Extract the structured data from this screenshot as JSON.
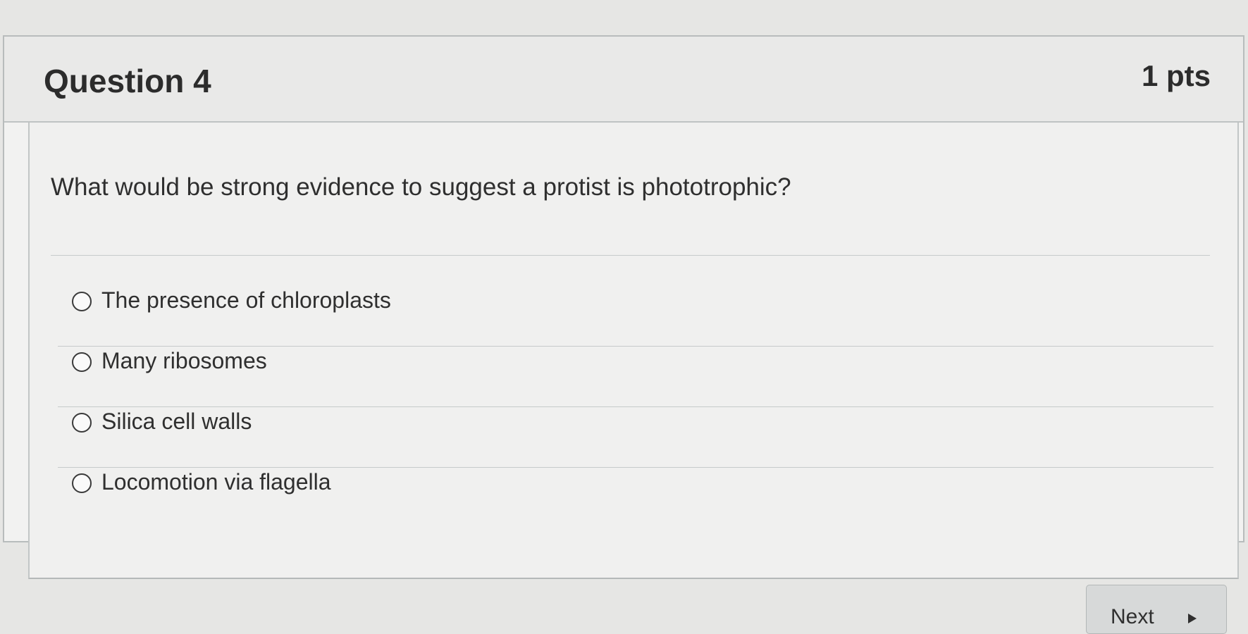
{
  "question": {
    "title": "Question 4",
    "points": "1 pts",
    "text": "What would be strong evidence to suggest a protist is phototrophic?",
    "answers": [
      {
        "label": "The presence of chloroplasts"
      },
      {
        "label": "Many ribosomes"
      },
      {
        "label": "Silica cell walls"
      },
      {
        "label": "Locomotion via flagella"
      }
    ]
  },
  "navigation": {
    "next_label": "Next",
    "next_icon": "triangle-right-icon"
  }
}
